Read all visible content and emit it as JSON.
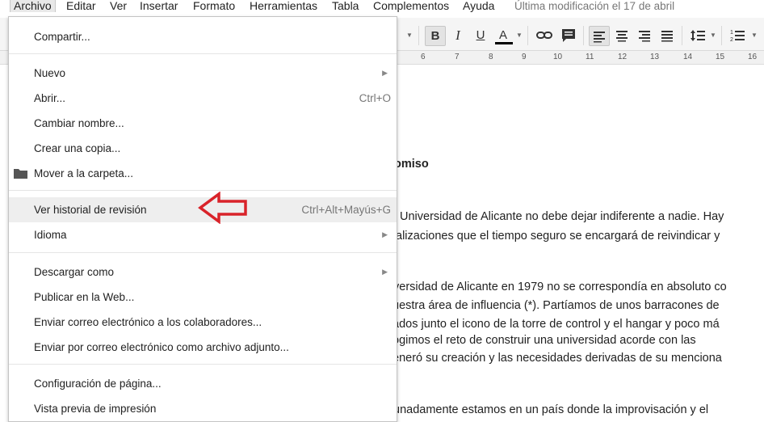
{
  "menubar": {
    "items": [
      "Archivo",
      "Editar",
      "Ver",
      "Insertar",
      "Formato",
      "Herramientas",
      "Tabla",
      "Complementos",
      "Ayuda"
    ],
    "last_modified": "Última modificación el 17 de abril"
  },
  "toolbar": {
    "bold": "B",
    "italic": "I",
    "underline": "U",
    "text_color": "A",
    "accent_color": "#000000"
  },
  "ruler": {
    "numbers": [
      "6",
      "7",
      "8",
      "9",
      "10",
      "11",
      "12",
      "13",
      "14",
      "15",
      "16"
    ]
  },
  "document": {
    "heading_fragment": "omiso",
    "lines": [
      "Universidad de Alicante no debe dejar indiferente a nadie. Hay",
      "alizaciones que el tiempo seguro se encargará de reivindicar y",
      "versidad de Alicante en 1979 no se correspondía en absoluto co",
      "uestra área de influencia (*). Partíamos de unos barracones de",
      "ados junto el icono de la torre de control y el hangar y poco má",
      "ogimos el reto de construir una universidad acorde con las",
      "eneró su creación y las necesidades derivadas de su menciona",
      "unadamente estamos en un país donde la improvisación y el"
    ]
  },
  "file_menu": {
    "share": "Compartir...",
    "new": "Nuevo",
    "open": "Abrir...",
    "open_shortcut": "Ctrl+O",
    "rename": "Cambiar nombre...",
    "make_copy": "Crear una copia...",
    "move_to_folder": "Mover a la carpeta...",
    "revision_history": "Ver historial de revisión",
    "revision_history_shortcut": "Ctrl+Alt+Mayús+G",
    "language": "Idioma",
    "download_as": "Descargar como",
    "publish_web": "Publicar en la Web...",
    "email_collaborators": "Enviar correo electrónico a los colaboradores...",
    "email_attachment": "Enviar por correo electrónico como archivo adjunto...",
    "page_setup": "Configuración de página...",
    "print_preview": "Vista previa de impresión"
  },
  "annotation": {
    "arrow_color": "#d9232a",
    "icon": "arrow-left-icon"
  }
}
